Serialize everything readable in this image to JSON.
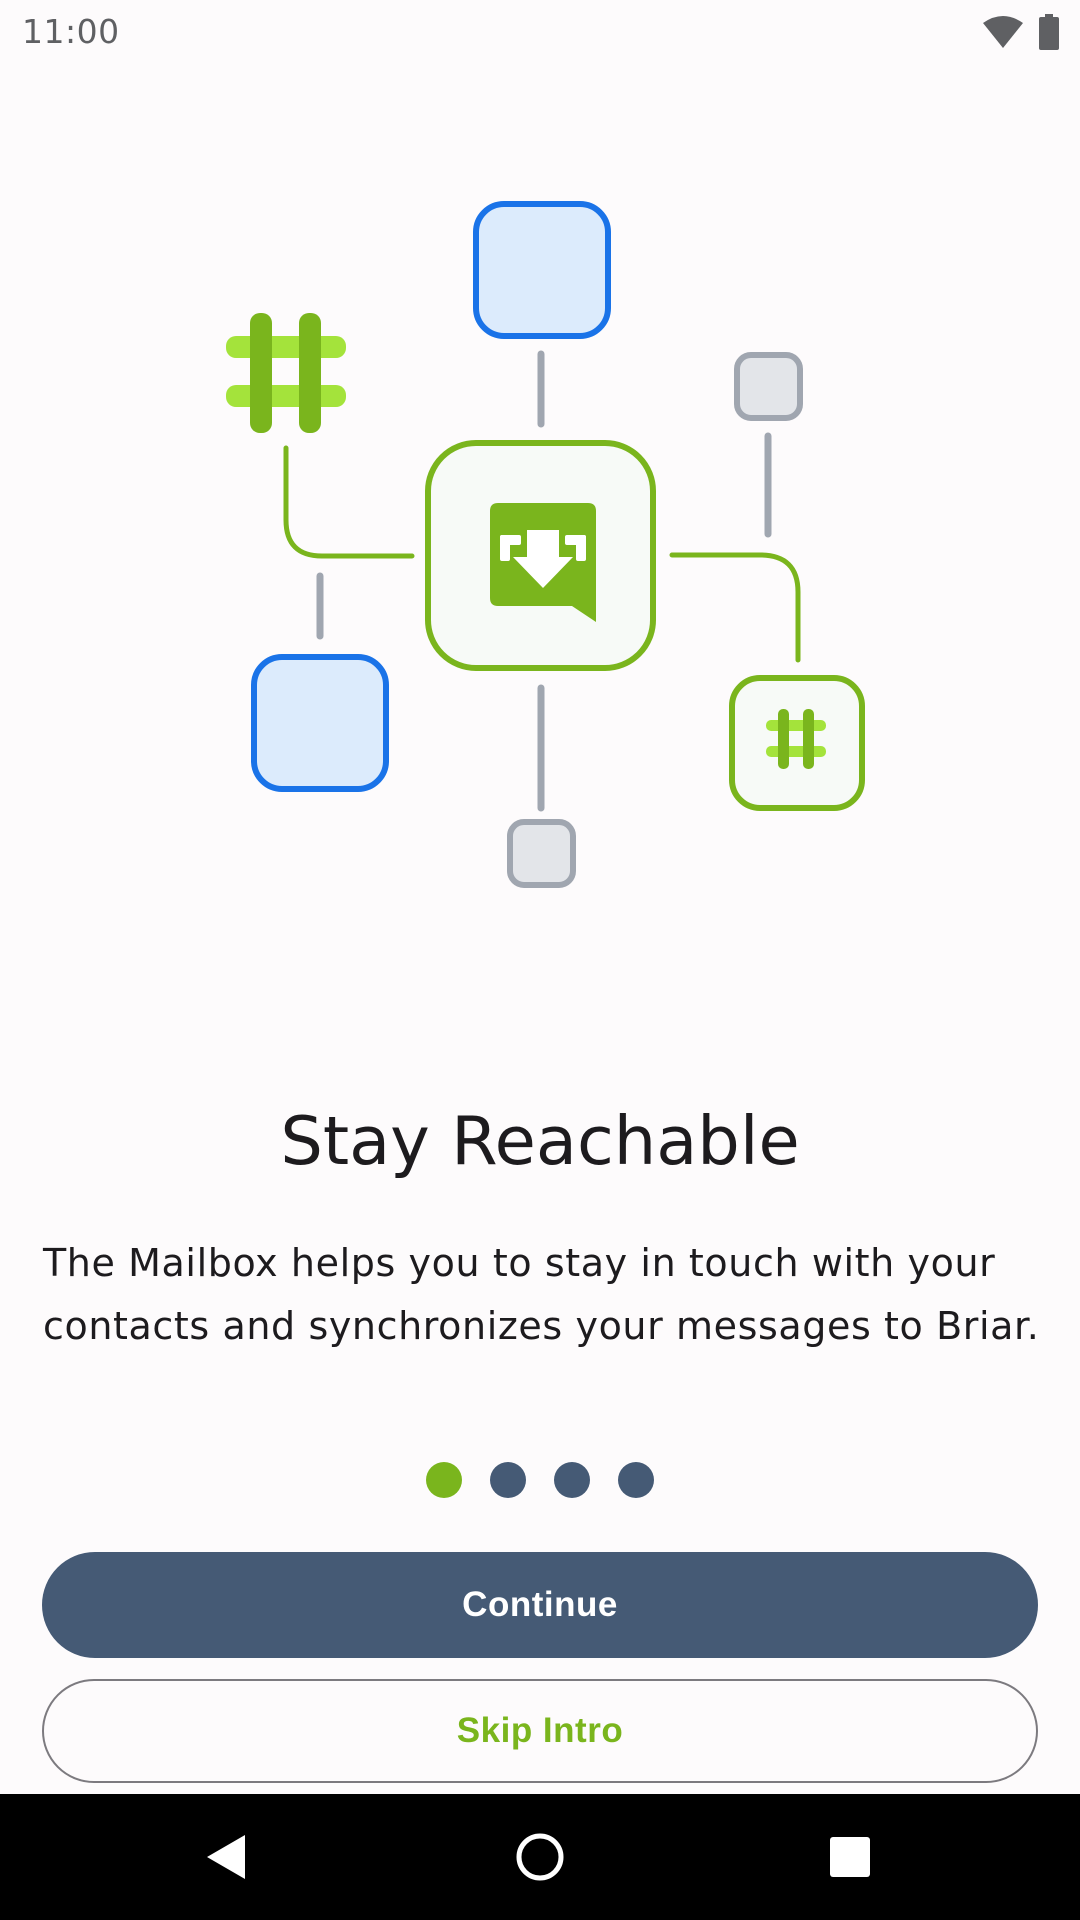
{
  "status_bar": {
    "time": "11:00",
    "icons": [
      "wifi-icon",
      "battery-icon"
    ]
  },
  "illustration": {
    "center_icon": "mailbox-icon",
    "nodes": [
      "briar-hash-icon",
      "contact-square",
      "device-square"
    ]
  },
  "onboarding": {
    "title": "Stay Reachable",
    "description": "The Mailbox helps you to stay in touch with your contacts and synchronizes your messages to Briar.",
    "page_count": 4,
    "current_page": 1
  },
  "buttons": {
    "continue_label": "Continue",
    "skip_label": "Skip Intro"
  },
  "nav_bar": {
    "icons": [
      "back-icon",
      "home-icon",
      "recents-icon"
    ]
  },
  "colors": {
    "primary": "#455a75",
    "accent_green": "#7ab51d",
    "light_green": "#a4e33b",
    "blue": "#1a73e8",
    "light_blue": "#dcebfc",
    "grey": "#a0a6b0",
    "light_grey": "#e3e5e9"
  }
}
